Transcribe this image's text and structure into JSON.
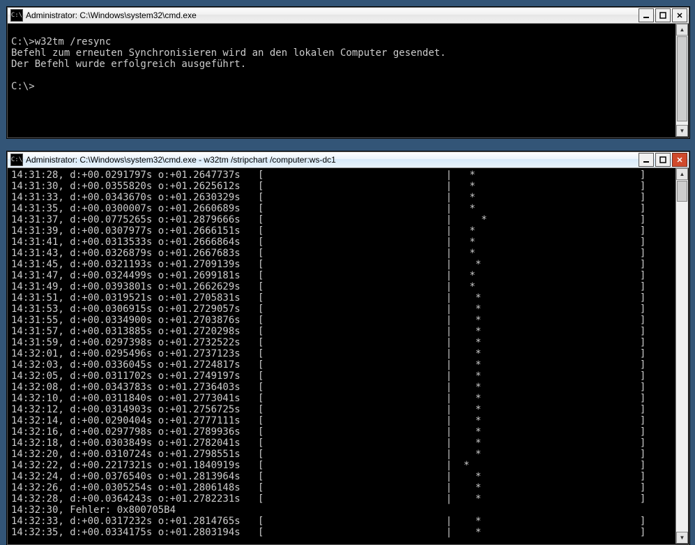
{
  "windows": {
    "top": {
      "title": "Administrator: C:\\Windows\\system32\\cmd.exe",
      "icon_label": "C:\\",
      "lines": [
        "",
        "C:\\>w32tm /resync",
        "Befehl zum erneuten Synchronisieren wird an den lokalen Computer gesendet.",
        "Der Befehl wurde erfolgreich ausgeführt.",
        "",
        "C:\\>"
      ]
    },
    "bottom": {
      "title": "Administrator: C:\\Windows\\system32\\cmd.exe - w32tm  /stripchart /computer:ws-dc1",
      "icon_label": "C:\\",
      "lines": [
        "14:31:28, d:+00.0291797s o:+01.2647737s   [                               |   *                            ]",
        "14:31:30, d:+00.0355820s o:+01.2625612s   [                               |   *                            ]",
        "14:31:33, d:+00.0343670s o:+01.2630329s   [                               |   *                            ]",
        "14:31:35, d:+00.0300007s o:+01.2660689s   [                               |   *                            ]",
        "14:31:37, d:+00.0775265s o:+01.2879666s   [                               |     *                          ]",
        "14:31:39, d:+00.0307977s o:+01.2666151s   [                               |   *                            ]",
        "14:31:41, d:+00.0313533s o:+01.2666864s   [                               |   *                            ]",
        "14:31:43, d:+00.0326879s o:+01.2667683s   [                               |   *                            ]",
        "14:31:45, d:+00.0321193s o:+01.2709139s   [                               |    *                           ]",
        "14:31:47, d:+00.0324499s o:+01.2699181s   [                               |   *                            ]",
        "14:31:49, d:+00.0393801s o:+01.2662629s   [                               |   *                            ]",
        "14:31:51, d:+00.0319521s o:+01.2705831s   [                               |    *                           ]",
        "14:31:53, d:+00.0306915s o:+01.2729057s   [                               |    *                           ]",
        "14:31:55, d:+00.0334900s o:+01.2703876s   [                               |    *                           ]",
        "14:31:57, d:+00.0313885s o:+01.2720298s   [                               |    *                           ]",
        "14:31:59, d:+00.0297398s o:+01.2732522s   [                               |    *                           ]",
        "14:32:01, d:+00.0295496s o:+01.2737123s   [                               |    *                           ]",
        "14:32:03, d:+00.0336045s o:+01.2724817s   [                               |    *                           ]",
        "14:32:05, d:+00.0311702s o:+01.2749197s   [                               |    *                           ]",
        "14:32:08, d:+00.0343783s o:+01.2736403s   [                               |    *                           ]",
        "14:32:10, d:+00.0311840s o:+01.2773041s   [                               |    *                           ]",
        "14:32:12, d:+00.0314903s o:+01.2756725s   [                               |    *                           ]",
        "14:32:14, d:+00.0290404s o:+01.2777111s   [                               |    *                           ]",
        "14:32:16, d:+00.0297798s o:+01.2789936s   [                               |    *                           ]",
        "14:32:18, d:+00.0303849s o:+01.2782041s   [                               |    *                           ]",
        "14:32:20, d:+00.0310724s o:+01.2798551s   [                               |    *                           ]",
        "14:32:22, d:+00.2217321s o:+01.1840919s   [                               |  *                             ]",
        "14:32:24, d:+00.0376540s o:+01.2813964s   [                               |    *                           ]",
        "14:32:26, d:+00.0305254s o:+01.2806148s   [                               |    *                           ]",
        "14:32:28, d:+00.0364243s o:+01.2782231s   [                               |    *                           ]",
        "14:32:30, Fehler: 0x800705B4",
        "14:32:33, d:+00.0317232s o:+01.2814765s   [                               |    *                           ]",
        "14:32:35, d:+00.0334175s o:+01.2803194s   [                               |    *                           ]"
      ]
    }
  }
}
